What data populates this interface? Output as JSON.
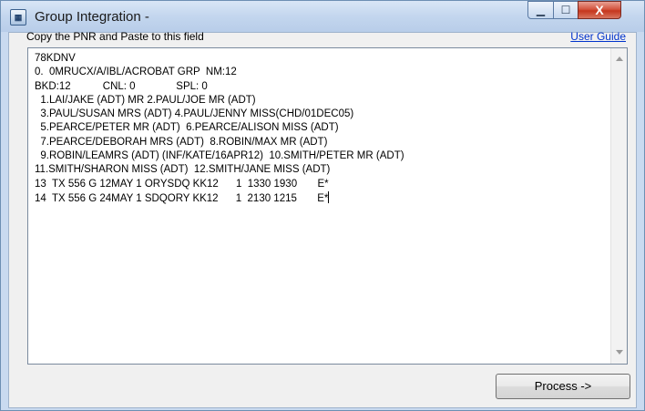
{
  "window": {
    "title": "Group Integration -",
    "controls": {
      "minimize": "▁",
      "maximize": "☐",
      "close": "X"
    }
  },
  "form": {
    "instructions": "Copy the PNR and Paste to this field",
    "user_guide_link": "User Guide",
    "pnr_text": "78KDNV\n0.  0MRUCX/A/IBL/ACROBAT GRP  NM:12\nBKD:12           CNL: 0              SPL: 0\n  1.LAI/JAKE (ADT) MR 2.PAUL/JOE MR (ADT)\n  3.PAUL/SUSAN MRS (ADT) 4.PAUL/JENNY MISS(CHD/01DEC05)\n  5.PEARCE/PETER MR (ADT)  6.PEARCE/ALISON MISS (ADT)\n  7.PEARCE/DEBORAH MRS (ADT)  8.ROBIN/MAX MR (ADT)\n  9.ROBIN/LEAMRS (ADT) (INF/KATE/16APR12)  10.SMITH/PETER MR (ADT)\n11.SMITH/SHARON MISS (ADT)  12.SMITH/JANE MISS (ADT)\n13  TX 556 G 12MAY 1 ORYSDQ KK12      1  1330 1930       E*\n14  TX 556 G 24MAY 1 SDQORY KK12      1  2130 1215       E*",
    "process_button": "Process ->"
  }
}
